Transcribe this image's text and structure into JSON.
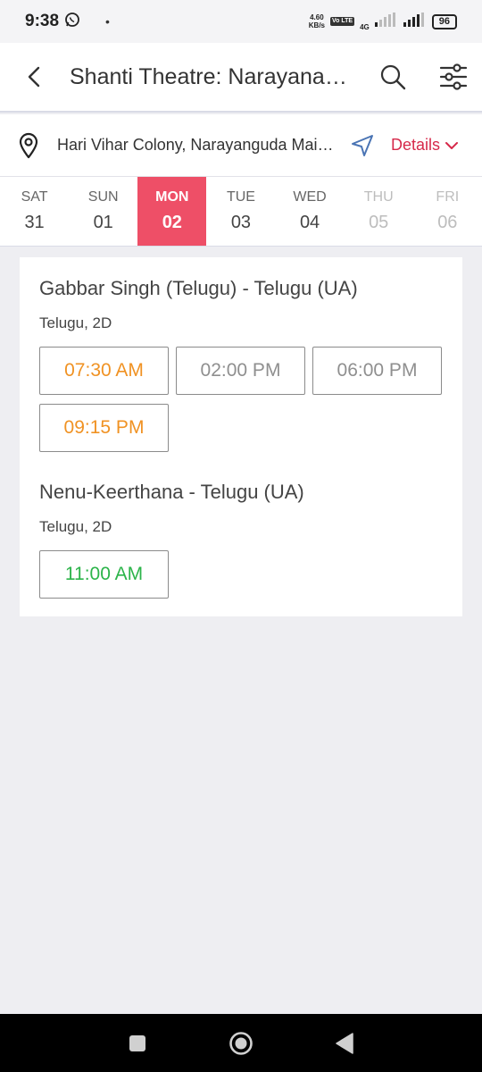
{
  "status_bar": {
    "time": "9:38",
    "dot": "•",
    "net_speed_value": "4.60",
    "net_speed_unit": "KB/s",
    "volte": "Vo LTE",
    "network": "4G",
    "battery": "96"
  },
  "header": {
    "title": "Shanti Theatre: Narayanaguda"
  },
  "address": {
    "text": "Hari Vihar Colony, Narayanguda Main Road",
    "details_label": "Details"
  },
  "dates": [
    {
      "day": "SAT",
      "num": "31",
      "state": "normal"
    },
    {
      "day": "SUN",
      "num": "01",
      "state": "normal"
    },
    {
      "day": "MON",
      "num": "02",
      "state": "selected"
    },
    {
      "day": "TUE",
      "num": "03",
      "state": "normal"
    },
    {
      "day": "WED",
      "num": "04",
      "state": "normal"
    },
    {
      "day": "THU",
      "num": "05",
      "state": "disabled"
    },
    {
      "day": "FRI",
      "num": "06",
      "state": "disabled"
    }
  ],
  "movies": [
    {
      "title": "Gabbar Singh (Telugu) - Telugu (UA)",
      "format": "Telugu, 2D",
      "showtimes": [
        {
          "time": "07:30 AM",
          "status": "fast"
        },
        {
          "time": "02:00 PM",
          "status": "grey"
        },
        {
          "time": "06:00 PM",
          "status": "grey"
        },
        {
          "time": "09:15 PM",
          "status": "fast"
        }
      ]
    },
    {
      "title": "Nenu-Keerthana - Telugu (UA)",
      "format": "Telugu, 2D",
      "showtimes": [
        {
          "time": "11:00 AM",
          "status": "available"
        }
      ]
    }
  ],
  "colors": {
    "accent": "#ee4f67",
    "details": "#d6294a",
    "fast_filling": "#f09223",
    "available": "#2cb44a",
    "unavailable": "#8f8f8f"
  },
  "icons": {
    "back": "back-arrow-icon",
    "search": "search-icon",
    "filter": "filter-sliders-icon",
    "location": "location-pin-icon",
    "navigate": "navigation-arrow-icon",
    "details": "chevron-down-icon"
  }
}
